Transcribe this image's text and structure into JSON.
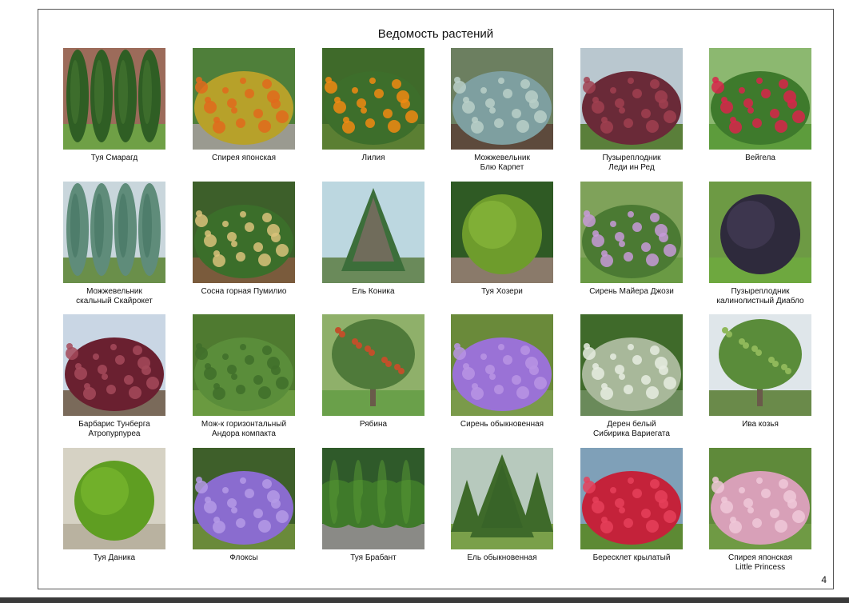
{
  "document": {
    "title": "Ведомость растений",
    "page_number": "4"
  },
  "plants": [
    {
      "line1": "Туя Смарагд",
      "line2": "",
      "icon": "thuja-columnar-photo"
    },
    {
      "line1": "Спирея японская",
      "line2": "",
      "icon": "spirea-hedge-photo"
    },
    {
      "line1": "Лилия",
      "line2": "",
      "icon": "daylily-photo"
    },
    {
      "line1": "Можжевельник",
      "line2": "Блю Карпет",
      "icon": "juniper-carpet-photo"
    },
    {
      "line1": "Пузыреплодник",
      "line2": "Леди ин Ред",
      "icon": "physocarpus-photo"
    },
    {
      "line1": "Вейгела",
      "line2": "",
      "icon": "weigela-photo"
    },
    {
      "line1": "Можжевельник",
      "line2": "скальный Скайрокет",
      "icon": "juniper-skyrocket-photo"
    },
    {
      "line1": "Сосна горная Пумилио",
      "line2": "",
      "icon": "mountain-pine-photo"
    },
    {
      "line1": "Ель Коника",
      "line2": "",
      "icon": "spruce-conica-photo"
    },
    {
      "line1": "Туя Хозери",
      "line2": "",
      "icon": "thuja-globe-photo"
    },
    {
      "line1": "Сирень Майера Джози",
      "line2": "",
      "icon": "lilac-meyer-photo"
    },
    {
      "line1": "Пузыреплодник",
      "line2": "калинолистный Диабло",
      "icon": "physocarpus-diablo-photo"
    },
    {
      "line1": "Барбарис Тунберга",
      "line2": "Атропурпуреа",
      "icon": "barberry-photo"
    },
    {
      "line1": "Мож-к горизонтальный",
      "line2": "Андора компакта",
      "icon": "juniper-horizontal-photo"
    },
    {
      "line1": "Рябина",
      "line2": "",
      "icon": "rowan-photo"
    },
    {
      "line1": "Сирень обыкновенная",
      "line2": "",
      "icon": "lilac-common-photo"
    },
    {
      "line1": "Дерен белый",
      "line2": "Сибирика Вариегата",
      "icon": "dogwood-photo"
    },
    {
      "line1": "Ива козья",
      "line2": "",
      "icon": "willow-photo"
    },
    {
      "line1": "Туя Даника",
      "line2": "",
      "icon": "thuja-danica-photo"
    },
    {
      "line1": "Флоксы",
      "line2": "",
      "icon": "phlox-photo"
    },
    {
      "line1": "Туя Брабант",
      "line2": "",
      "icon": "thuja-hedge-photo"
    },
    {
      "line1": "Ель обыкновенная",
      "line2": "",
      "icon": "spruce-common-photo"
    },
    {
      "line1": "Бересклет крылатый",
      "line2": "",
      "icon": "euonymus-photo"
    },
    {
      "line1": "Спирея японская",
      "line2": "Little Princess",
      "icon": "spirea-princess-photo"
    }
  ]
}
